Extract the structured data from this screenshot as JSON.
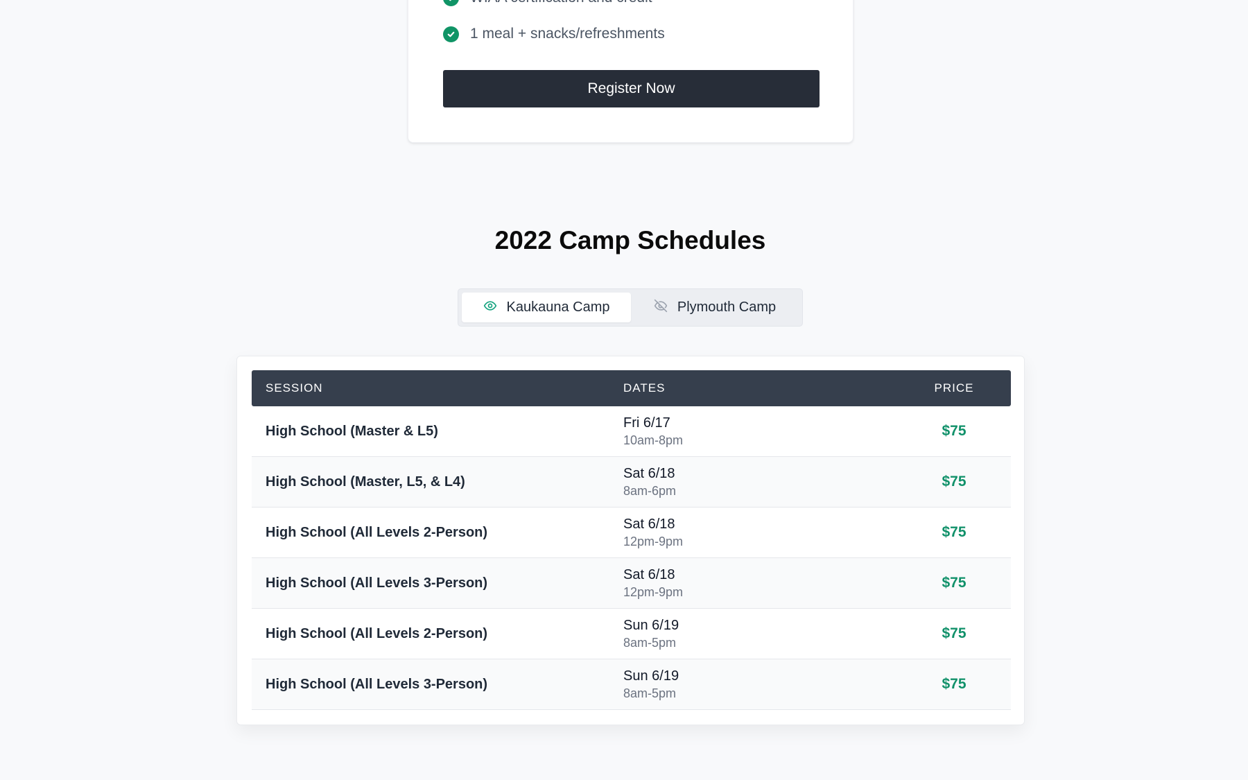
{
  "pricing_card": {
    "features": [
      "WIAA certification and credit",
      "1 meal + snacks/refreshments"
    ],
    "register_label": "Register Now",
    "check_color": "#109466"
  },
  "schedule": {
    "title": "2022 Camp Schedules",
    "tabs": [
      {
        "label": "Kaukauna Camp",
        "icon": "eye-icon",
        "active": true
      },
      {
        "label": "Plymouth Camp",
        "icon": "eye-off-icon",
        "active": false
      }
    ],
    "columns": {
      "session": "SESSION",
      "dates": "DATES",
      "price": "PRICE"
    },
    "rows": [
      {
        "session": "High School (Master & L5)",
        "date": "Fri 6/17",
        "time": "10am-8pm",
        "price": "$75"
      },
      {
        "session": "High School (Master, L5, & L4)",
        "date": "Sat 6/18",
        "time": "8am-6pm",
        "price": "$75"
      },
      {
        "session": "High School (All Levels 2-Person)",
        "date": "Sat 6/18",
        "time": "12pm-9pm",
        "price": "$75"
      },
      {
        "session": "High School (All Levels 3-Person)",
        "date": "Sat 6/18",
        "time": "12pm-9pm",
        "price": "$75"
      },
      {
        "session": "High School (All Levels 2-Person)",
        "date": "Sun 6/19",
        "time": "8am-5pm",
        "price": "$75"
      },
      {
        "session": "High School (All Levels 3-Person)",
        "date": "Sun 6/19",
        "time": "8am-5pm",
        "price": "$75"
      }
    ],
    "price_color": "#11916a",
    "header_color": "#363f4d"
  }
}
